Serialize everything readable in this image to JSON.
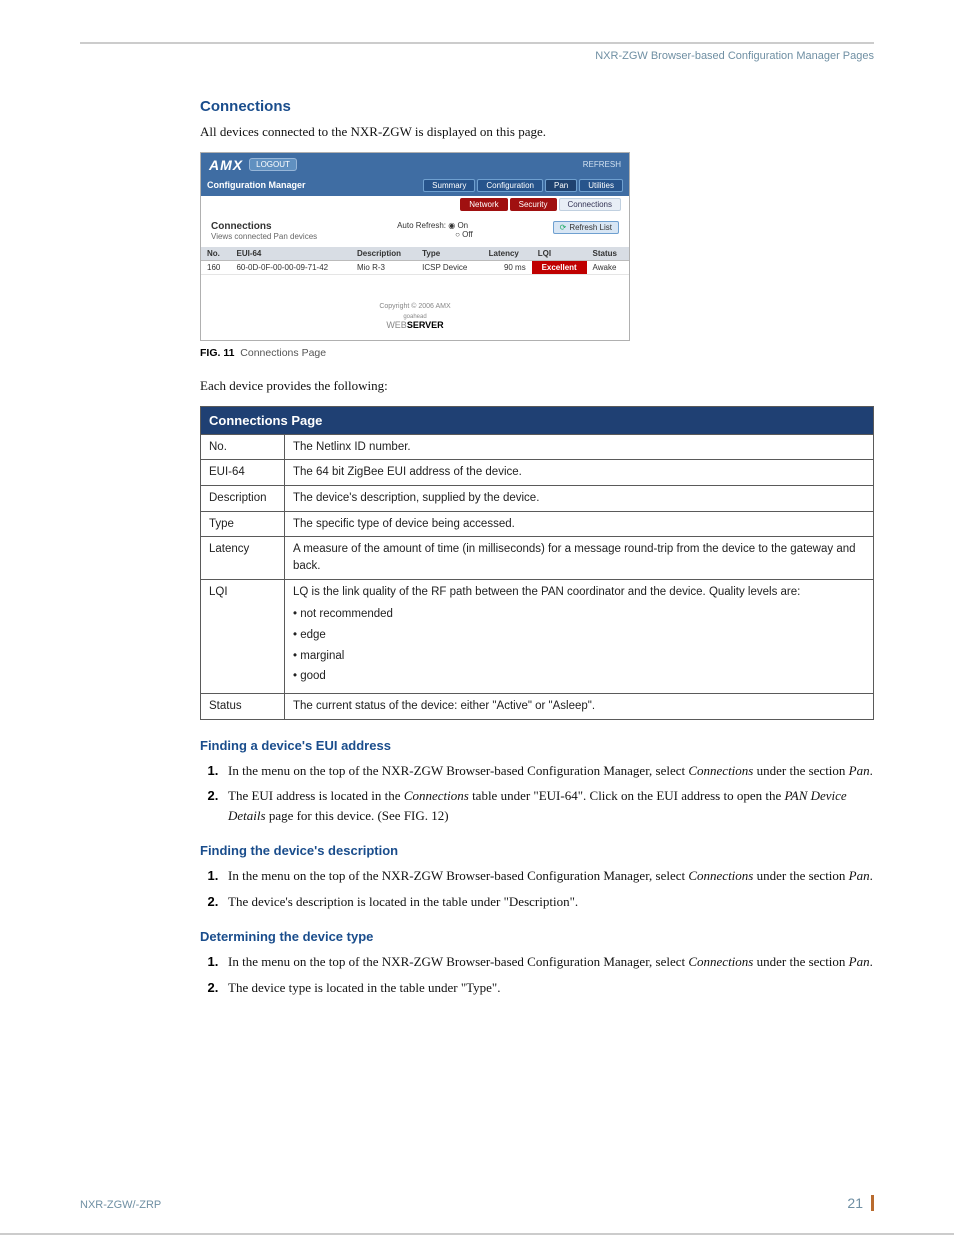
{
  "header": {
    "title": "NXR-ZGW Browser-based Configuration Manager Pages"
  },
  "section": {
    "title": "Connections",
    "intro": "All devices connected to the NXR-ZGW is displayed on this page."
  },
  "shot": {
    "logo_text": "AMX",
    "logout": "LOGOUT",
    "refresh_top": "REFRESH",
    "cm_label": "Configuration Manager",
    "tabs": [
      "Summary",
      "Configuration",
      "Pan",
      "Utilities"
    ],
    "subtabs": {
      "network": "Network",
      "security": "Security",
      "connections": "Connections"
    },
    "panel_title": "Connections",
    "panel_sub": "Views connected Pan devices",
    "auto_refresh_label": "Auto Refresh:",
    "auto_on": "On",
    "auto_off": "Off",
    "refresh_list": "Refresh List",
    "cols": {
      "no": "No.",
      "eui": "EUI-64",
      "desc": "Description",
      "type": "Type",
      "latency": "Latency",
      "lqi": "LQI",
      "status": "Status"
    },
    "row": {
      "no": "160",
      "eui": "60-0D-0F-00-00-09-71-42",
      "desc": "Mio R-3",
      "type": "ICSP Device",
      "latency": "90 ms",
      "lqi": "Excellent",
      "status": "Awake"
    },
    "copyright": "Copyright © 2006 AMX",
    "goahead": "goahead",
    "webserver_a": "WEB",
    "webserver_b": "SERVER"
  },
  "figcap": {
    "label": "FIG. 11",
    "text": "Connections Page"
  },
  "after_fig": "Each device provides the following:",
  "table": {
    "header": "Connections Page",
    "rows": [
      {
        "k": "No.",
        "v": "The Netlinx ID number."
      },
      {
        "k": "EUI-64",
        "v": "The 64 bit ZigBee EUI address of the device."
      },
      {
        "k": "Description",
        "v": "The device's description, supplied by the device."
      },
      {
        "k": "Type",
        "v": "The specific type of device being accessed."
      },
      {
        "k": "Latency",
        "v": "A measure of the amount of time (in milliseconds) for a message round-trip from the device to the gateway and back."
      },
      {
        "k": "LQI",
        "v_lead": "LQ is the link quality of the RF path between the PAN coordinator and the device. Quality levels are:",
        "bullets": [
          "not recommended",
          "edge",
          "marginal",
          "good"
        ]
      },
      {
        "k": "Status",
        "v": "The current status of the device: either \"Active\" or \"Asleep\"."
      }
    ]
  },
  "sub1": {
    "title": "Finding a device's EUI address",
    "steps": [
      {
        "pre": "In the menu on the top of the NXR-ZGW Browser-based Configuration Manager, select ",
        "em1": "Connections",
        "mid": " under the section ",
        "em2": "Pan",
        "post": "."
      },
      {
        "pre": "The EUI address is located in the ",
        "em1": "Connections",
        "mid": " table under \"EUI-64\". Click on the EUI address to open the ",
        "em2": "PAN Device Details",
        "post": " page for this device. (See FIG. 12)"
      }
    ]
  },
  "sub2": {
    "title": "Finding the device's description",
    "steps": [
      {
        "pre": "In the menu on the top of the NXR-ZGW Browser-based Configuration Manager, select ",
        "em1": "Connections",
        "mid": " under the section ",
        "em2": "Pan",
        "post": "."
      },
      {
        "plain": "The device's description is located in the table under \"Description\"."
      }
    ]
  },
  "sub3": {
    "title": "Determining the device type",
    "steps": [
      {
        "pre": "In the menu on the top of the NXR-ZGW Browser-based Configuration Manager, select ",
        "em1": "Connections",
        "mid": " under the section ",
        "em2": "Pan",
        "post": "."
      },
      {
        "plain": "The device type is located in the table under \"Type\"."
      }
    ]
  },
  "footer": {
    "left": "NXR-ZGW/-ZRP",
    "page": "21"
  }
}
